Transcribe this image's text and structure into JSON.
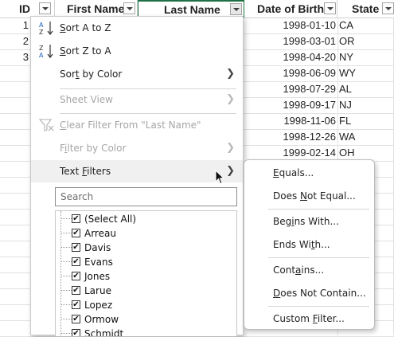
{
  "headers": {
    "id": "ID",
    "first_name": "First Name",
    "last_name": "Last Name",
    "dob": "Date of Birth",
    "state": "State"
  },
  "rows": [
    {
      "id": "1",
      "dob": "1998-01-10",
      "state": "CA"
    },
    {
      "id": "2",
      "dob": "1998-03-01",
      "state": "OR"
    },
    {
      "id": "3",
      "dob": "1998-04-20",
      "state": "NY"
    },
    {
      "id": "",
      "dob": "1998-06-09",
      "state": "WY"
    },
    {
      "id": "",
      "dob": "1998-07-29",
      "state": "AL"
    },
    {
      "id": "",
      "dob": "1998-09-17",
      "state": "NJ"
    },
    {
      "id": "",
      "dob": "1998-11-06",
      "state": "FL"
    },
    {
      "id": "",
      "dob": "1998-12-26",
      "state": "WA"
    },
    {
      "id": "",
      "dob": "1999-02-14",
      "state": "OH"
    }
  ],
  "menu": {
    "sort_az": {
      "u": "S",
      "rest": "ort A to Z"
    },
    "sort_za": {
      "u": "S",
      "rest": "ort Z to A"
    },
    "sort_by_color": {
      "pre": "Sor",
      "u": "t",
      "rest": " by Color"
    },
    "sheet_view": "Sheet View",
    "clear_filter": {
      "u": "C",
      "rest": "lear Filter From \"Last Name\""
    },
    "filter_by_color": {
      "pre": "F",
      "u": "i",
      "rest": "lter by Color"
    },
    "text_filters": {
      "u": "F",
      "pre": "Text ",
      "rest": "ilters"
    },
    "search_placeholder": "Search",
    "list_items": [
      {
        "label": "(Select All)",
        "checked": true
      },
      {
        "label": "Arreau",
        "checked": true
      },
      {
        "label": "Davis",
        "checked": true
      },
      {
        "label": "Evans",
        "checked": true
      },
      {
        "label": "Jones",
        "checked": true
      },
      {
        "label": "Larue",
        "checked": true
      },
      {
        "label": "Lopez",
        "checked": true
      },
      {
        "label": "Ormow",
        "checked": true
      },
      {
        "label": "Schmidt",
        "checked": true
      }
    ]
  },
  "submenu": {
    "equals": {
      "u": "E",
      "rest": "quals..."
    },
    "not_equal": {
      "pre": "Does ",
      "u": "N",
      "rest": "ot Equal..."
    },
    "begins_with": {
      "pre": "Beg",
      "u": "i",
      "rest": "ns With..."
    },
    "ends_with": {
      "pre": "Ends Wi",
      "u": "t",
      "rest": "h..."
    },
    "contains": {
      "pre": "Cont",
      "u": "a",
      "rest": "ins..."
    },
    "not_contain": {
      "u": "D",
      "rest": "oes Not Contain..."
    },
    "custom_filter": {
      "pre": "Custom ",
      "u": "F",
      "rest": "ilter..."
    }
  },
  "colors": {
    "selection_border": "#1e7145",
    "menu_hover": "#f0f0f0",
    "disabled_text": "#a6a6a6"
  }
}
